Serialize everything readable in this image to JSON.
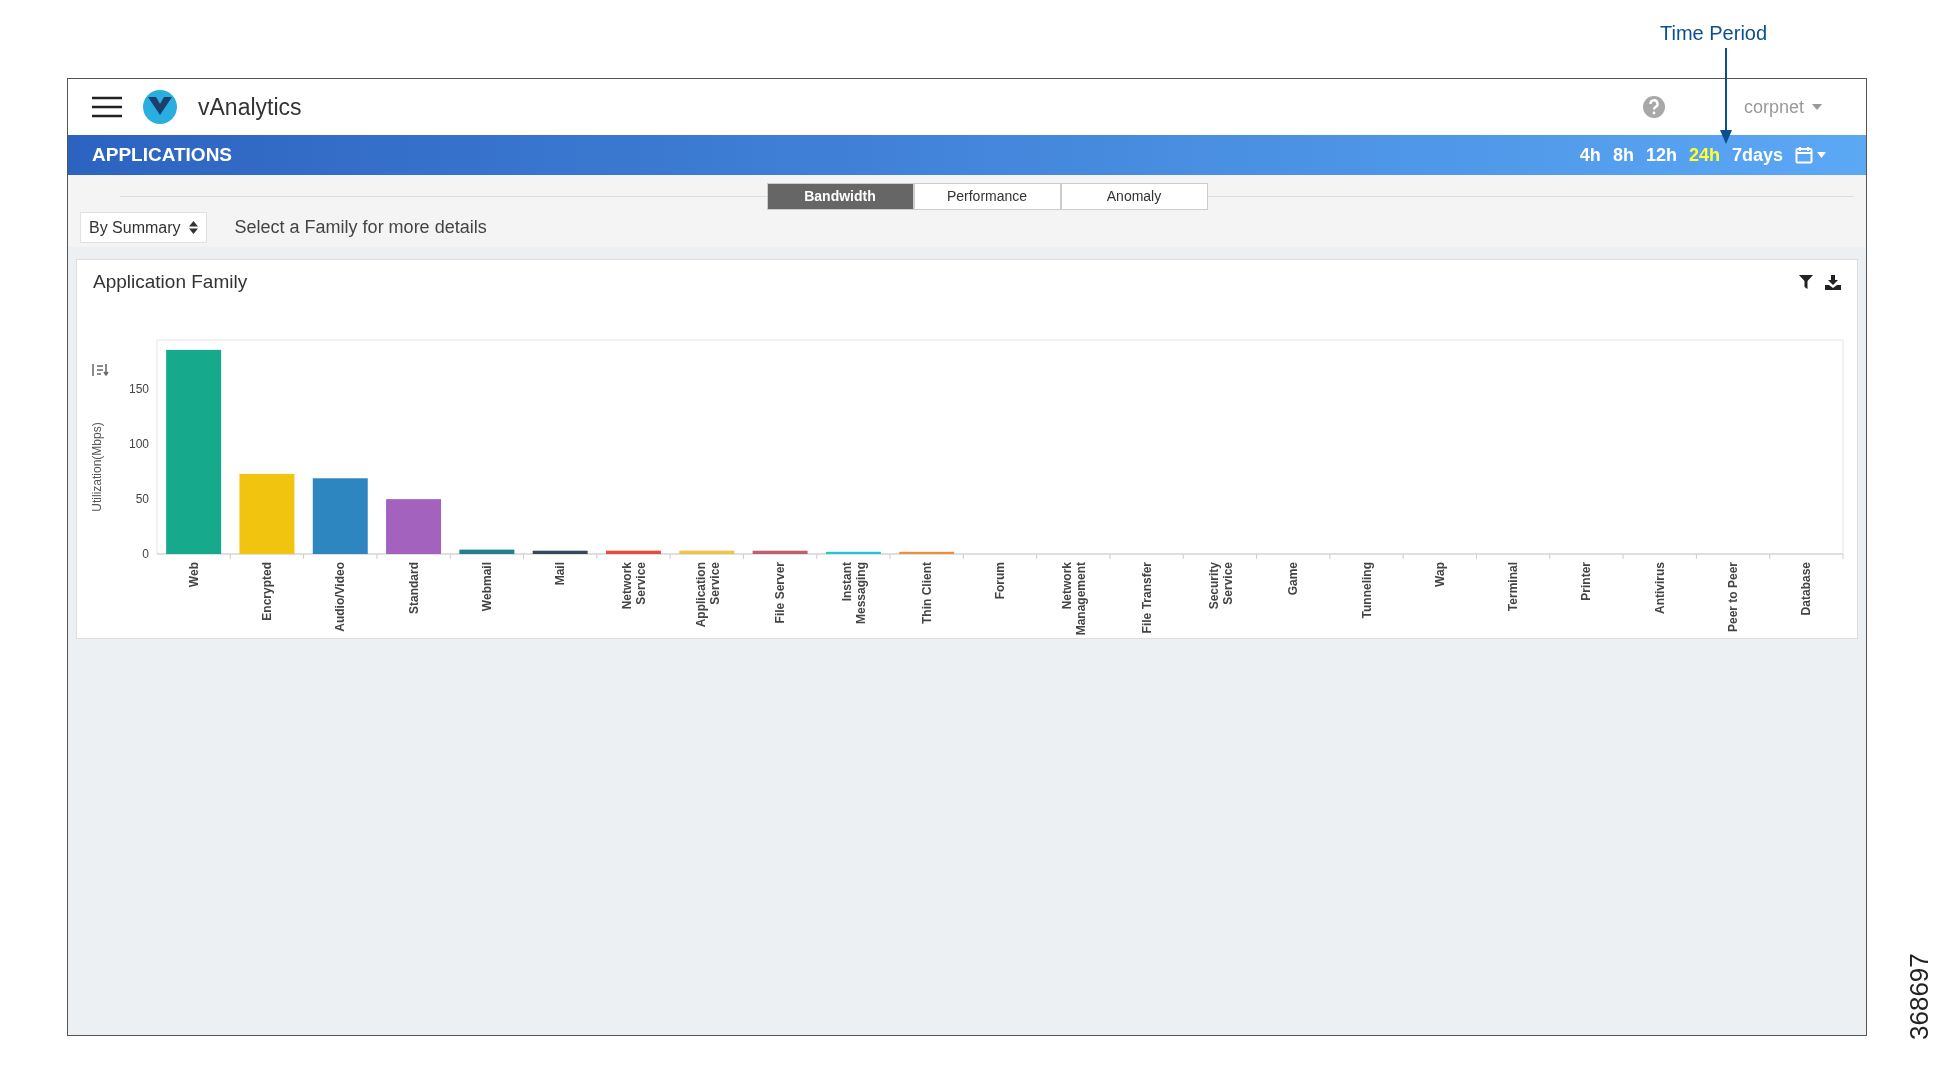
{
  "callout": {
    "label": "Time Period"
  },
  "figure_number": "368697",
  "header": {
    "app_name": "vAnalytics",
    "user_menu": "corpnet"
  },
  "section_bar": {
    "title": "APPLICATIONS",
    "time_ranges": [
      {
        "label": "4h",
        "selected": false
      },
      {
        "label": "8h",
        "selected": false
      },
      {
        "label": "12h",
        "selected": false
      },
      {
        "label": "24h",
        "selected": true
      },
      {
        "label": "7days",
        "selected": false
      }
    ]
  },
  "view_tabs": [
    {
      "label": "Bandwidth",
      "selected": true
    },
    {
      "label": "Performance",
      "selected": false
    },
    {
      "label": "Anomaly",
      "selected": false
    }
  ],
  "summary_select": {
    "value": "By Summary"
  },
  "hint": "Select a Family for more details",
  "panel": {
    "title": "Application Family",
    "chart_data": {
      "type": "bar",
      "ylabel": "Utilization(Mbps)",
      "yticks": [
        0,
        50,
        100,
        150
      ],
      "ylim": [
        0,
        195
      ],
      "categories": [
        "Web",
        "Encrypted",
        "Audio/Video",
        "Standard",
        "Webmail",
        "Mail",
        "Network\nService",
        "Application\nService",
        "File Server",
        "Instant\nMessaging",
        "Thin Client",
        "Forum",
        "Network\nManagement",
        "File Transfer",
        "Security\nService",
        "Game",
        "Tunneling",
        "Wap",
        "Terminal",
        "Printer",
        "Antivirus",
        "Peer to Peer",
        "Database"
      ],
      "colors": [
        "#17a98c",
        "#f1c40f",
        "#2e86c1",
        "#a262be",
        "#23818c",
        "#34495e",
        "#e74c3c",
        "#f5c244",
        "#c0606a",
        "#1ec6d6",
        "#e8913a"
      ],
      "series": [
        {
          "values": [
            186,
            73,
            69,
            50,
            4,
            3,
            3,
            3,
            3,
            2,
            2,
            0,
            0,
            0,
            0,
            0,
            0,
            0,
            0,
            0,
            0,
            0,
            0
          ]
        }
      ]
    }
  }
}
